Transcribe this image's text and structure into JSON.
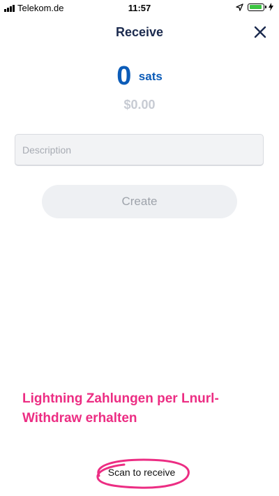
{
  "status_bar": {
    "carrier": "Telekom.de",
    "time": "11:57"
  },
  "header": {
    "title": "Receive"
  },
  "amount": {
    "value": "0",
    "unit": "sats",
    "fiat": "$0.00"
  },
  "description": {
    "placeholder": "Description",
    "value": ""
  },
  "create_button": {
    "label": "Create"
  },
  "annotation": {
    "line1": "Lightning Zahlungen per Lnurl-",
    "line2": "Withdraw erhalten"
  },
  "scan": {
    "label": "Scan to receive"
  },
  "colors": {
    "accent": "#0c5cb8",
    "title": "#1b2a4e",
    "annotation": "#ec2d83",
    "battery": "#3cc441"
  }
}
